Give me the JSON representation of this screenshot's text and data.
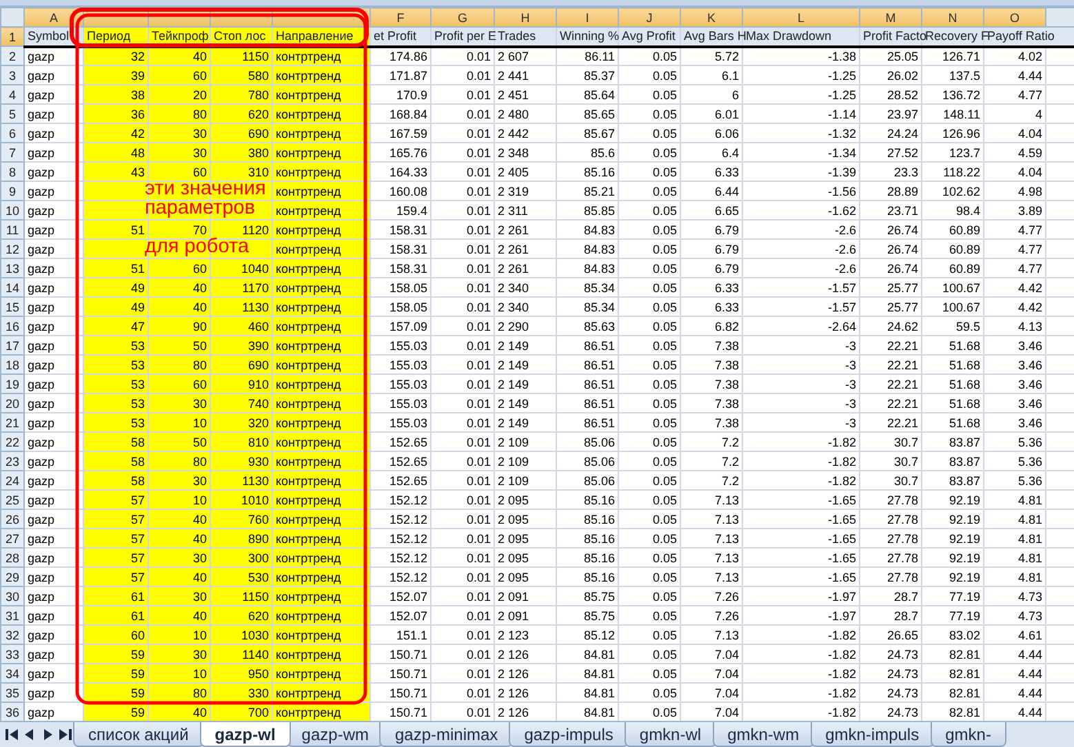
{
  "sheet": {
    "columns": [
      {
        "letter": "A",
        "kind": "text",
        "highlighted": false
      },
      {
        "kind": "number",
        "highlighted": true
      },
      {
        "kind": "number",
        "highlighted": true
      },
      {
        "kind": "number",
        "highlighted": true
      },
      {
        "kind": "text",
        "highlighted": true
      },
      {
        "letter": "F",
        "kind": "number",
        "highlighted": false
      },
      {
        "letter": "G",
        "kind": "number",
        "highlighted": false
      },
      {
        "letter": "H",
        "kind": "text",
        "highlighted": false
      },
      {
        "letter": "I",
        "kind": "number",
        "highlighted": false
      },
      {
        "letter": "J",
        "kind": "number",
        "highlighted": false
      },
      {
        "letter": "K",
        "kind": "number",
        "highlighted": false
      },
      {
        "letter": "L",
        "kind": "number",
        "highlighted": false
      },
      {
        "letter": "M",
        "kind": "number",
        "highlighted": false
      },
      {
        "letter": "N",
        "kind": "number",
        "highlighted": false
      },
      {
        "letter": "O",
        "kind": "number",
        "highlighted": false
      }
    ],
    "header_row": {
      "label": "1",
      "selected": true,
      "cells": [
        "Symbol",
        "Период",
        "Тейкпроф",
        "Стоп лос",
        "Направление",
        "et Profit",
        "Profit per E",
        "Trades",
        "Winning %",
        "Avg Profit",
        "Avg Bars H",
        "Max Drawdown",
        "Profit Facto",
        "Recovery F",
        "Payoff Ratio"
      ]
    },
    "rows": [
      {
        "label": "2",
        "cells": [
          "gazp",
          "32",
          "40",
          "1150",
          "контртренд",
          "174.86",
          "0.01",
          "2 607",
          "86.11",
          "0.05",
          "5.72",
          "-1.38",
          "25.05",
          "126.71",
          "4.02"
        ]
      },
      {
        "label": "3",
        "cells": [
          "gazp",
          "39",
          "60",
          "580",
          "контртренд",
          "171.87",
          "0.01",
          "2 441",
          "85.37",
          "0.05",
          "6.1",
          "-1.25",
          "26.02",
          "137.5",
          "4.44"
        ]
      },
      {
        "label": "4",
        "cells": [
          "gazp",
          "38",
          "20",
          "780",
          "контртренд",
          "170.9",
          "0.01",
          "2 451",
          "85.64",
          "0.05",
          "6",
          "-1.25",
          "28.52",
          "136.72",
          "4.77"
        ]
      },
      {
        "label": "5",
        "cells": [
          "gazp",
          "36",
          "80",
          "620",
          "контртренд",
          "168.84",
          "0.01",
          "2 480",
          "85.65",
          "0.05",
          "6.01",
          "-1.14",
          "23.97",
          "148.11",
          "4"
        ]
      },
      {
        "label": "6",
        "cells": [
          "gazp",
          "42",
          "30",
          "690",
          "контртренд",
          "167.59",
          "0.01",
          "2 442",
          "85.67",
          "0.05",
          "6.06",
          "-1.32",
          "24.24",
          "126.96",
          "4.04"
        ]
      },
      {
        "label": "7",
        "cells": [
          "gazp",
          "48",
          "30",
          "380",
          "контртренд",
          "165.76",
          "0.01",
          "2 348",
          "85.6",
          "0.05",
          "6.4",
          "-1.34",
          "27.52",
          "123.7",
          "4.59"
        ]
      },
      {
        "label": "8",
        "cells": [
          "gazp",
          "43",
          "60",
          "310",
          "контртренд",
          "164.33",
          "0.01",
          "2 405",
          "85.16",
          "0.05",
          "6.33",
          "-1.39",
          "23.3",
          "118.22",
          "4.04"
        ]
      },
      {
        "label": "9",
        "cells": [
          "gazp",
          null,
          null,
          null,
          "контртренд",
          "160.08",
          "0.01",
          "2 319",
          "85.21",
          "0.05",
          "6.44",
          "-1.56",
          "28.89",
          "102.62",
          "4.98"
        ]
      },
      {
        "label": "10",
        "cells": [
          "gazp",
          null,
          null,
          null,
          "контртренд",
          "159.4",
          "0.01",
          "2 311",
          "85.85",
          "0.05",
          "6.65",
          "-1.62",
          "23.71",
          "98.4",
          "3.89"
        ]
      },
      {
        "label": "11",
        "cells": [
          "gazp",
          "51",
          "70",
          "1120",
          "контртренд",
          "158.31",
          "0.01",
          "2 261",
          "84.83",
          "0.05",
          "6.79",
          "-2.6",
          "26.74",
          "60.89",
          "4.77"
        ]
      },
      {
        "label": "12",
        "cells": [
          "gazp",
          null,
          null,
          null,
          "контртренд",
          "158.31",
          "0.01",
          "2 261",
          "84.83",
          "0.05",
          "6.79",
          "-2.6",
          "26.74",
          "60.89",
          "4.77"
        ]
      },
      {
        "label": "13",
        "cells": [
          "gazp",
          "51",
          "60",
          "1040",
          "контртренд",
          "158.31",
          "0.01",
          "2 261",
          "84.83",
          "0.05",
          "6.79",
          "-2.6",
          "26.74",
          "60.89",
          "4.77"
        ]
      },
      {
        "label": "14",
        "cells": [
          "gazp",
          "49",
          "40",
          "1170",
          "контртренд",
          "158.05",
          "0.01",
          "2 340",
          "85.34",
          "0.05",
          "6.33",
          "-1.57",
          "25.77",
          "100.67",
          "4.42"
        ]
      },
      {
        "label": "15",
        "cells": [
          "gazp",
          "49",
          "40",
          "1130",
          "контртренд",
          "158.05",
          "0.01",
          "2 340",
          "85.34",
          "0.05",
          "6.33",
          "-1.57",
          "25.77",
          "100.67",
          "4.42"
        ]
      },
      {
        "label": "16",
        "cells": [
          "gazp",
          "47",
          "90",
          "460",
          "контртренд",
          "157.09",
          "0.01",
          "2 290",
          "85.63",
          "0.05",
          "6.82",
          "-2.64",
          "24.62",
          "59.5",
          "4.13"
        ]
      },
      {
        "label": "17",
        "cells": [
          "gazp",
          "53",
          "50",
          "390",
          "контртренд",
          "155.03",
          "0.01",
          "2 149",
          "86.51",
          "0.05",
          "7.38",
          "-3",
          "22.21",
          "51.68",
          "3.46"
        ]
      },
      {
        "label": "18",
        "cells": [
          "gazp",
          "53",
          "80",
          "690",
          "контртренд",
          "155.03",
          "0.01",
          "2 149",
          "86.51",
          "0.05",
          "7.38",
          "-3",
          "22.21",
          "51.68",
          "3.46"
        ]
      },
      {
        "label": "19",
        "cells": [
          "gazp",
          "53",
          "60",
          "910",
          "контртренд",
          "155.03",
          "0.01",
          "2 149",
          "86.51",
          "0.05",
          "7.38",
          "-3",
          "22.21",
          "51.68",
          "3.46"
        ]
      },
      {
        "label": "20",
        "cells": [
          "gazp",
          "53",
          "30",
          "740",
          "контртренд",
          "155.03",
          "0.01",
          "2 149",
          "86.51",
          "0.05",
          "7.38",
          "-3",
          "22.21",
          "51.68",
          "3.46"
        ]
      },
      {
        "label": "21",
        "cells": [
          "gazp",
          "53",
          "10",
          "320",
          "контртренд",
          "155.03",
          "0.01",
          "2 149",
          "86.51",
          "0.05",
          "7.38",
          "-3",
          "22.21",
          "51.68",
          "3.46"
        ]
      },
      {
        "label": "22",
        "cells": [
          "gazp",
          "58",
          "50",
          "810",
          "контртренд",
          "152.65",
          "0.01",
          "2 109",
          "85.06",
          "0.05",
          "7.2",
          "-1.82",
          "30.7",
          "83.87",
          "5.36"
        ]
      },
      {
        "label": "23",
        "cells": [
          "gazp",
          "58",
          "80",
          "930",
          "контртренд",
          "152.65",
          "0.01",
          "2 109",
          "85.06",
          "0.05",
          "7.2",
          "-1.82",
          "30.7",
          "83.87",
          "5.36"
        ]
      },
      {
        "label": "24",
        "cells": [
          "gazp",
          "58",
          "30",
          "1130",
          "контртренд",
          "152.65",
          "0.01",
          "2 109",
          "85.06",
          "0.05",
          "7.2",
          "-1.82",
          "30.7",
          "83.87",
          "5.36"
        ]
      },
      {
        "label": "25",
        "cells": [
          "gazp",
          "57",
          "10",
          "1010",
          "контртренд",
          "152.12",
          "0.01",
          "2 095",
          "85.16",
          "0.05",
          "7.13",
          "-1.65",
          "27.78",
          "92.19",
          "4.81"
        ]
      },
      {
        "label": "26",
        "cells": [
          "gazp",
          "57",
          "40",
          "760",
          "контртренд",
          "152.12",
          "0.01",
          "2 095",
          "85.16",
          "0.05",
          "7.13",
          "-1.65",
          "27.78",
          "92.19",
          "4.81"
        ]
      },
      {
        "label": "27",
        "cells": [
          "gazp",
          "57",
          "40",
          "890",
          "контртренд",
          "152.12",
          "0.01",
          "2 095",
          "85.16",
          "0.05",
          "7.13",
          "-1.65",
          "27.78",
          "92.19",
          "4.81"
        ]
      },
      {
        "label": "28",
        "cells": [
          "gazp",
          "57",
          "30",
          "300",
          "контртренд",
          "152.12",
          "0.01",
          "2 095",
          "85.16",
          "0.05",
          "7.13",
          "-1.65",
          "27.78",
          "92.19",
          "4.81"
        ]
      },
      {
        "label": "29",
        "cells": [
          "gazp",
          "57",
          "40",
          "530",
          "контртренд",
          "152.12",
          "0.01",
          "2 095",
          "85.16",
          "0.05",
          "7.13",
          "-1.65",
          "27.78",
          "92.19",
          "4.81"
        ]
      },
      {
        "label": "30",
        "cells": [
          "gazp",
          "61",
          "30",
          "1150",
          "контртренд",
          "152.07",
          "0.01",
          "2 091",
          "85.75",
          "0.05",
          "7.26",
          "-1.97",
          "28.7",
          "77.19",
          "4.73"
        ]
      },
      {
        "label": "31",
        "cells": [
          "gazp",
          "61",
          "40",
          "620",
          "контртренд",
          "152.07",
          "0.01",
          "2 091",
          "85.75",
          "0.05",
          "7.26",
          "-1.97",
          "28.7",
          "77.19",
          "4.73"
        ]
      },
      {
        "label": "32",
        "cells": [
          "gazp",
          "60",
          "10",
          "1030",
          "контртренд",
          "151.1",
          "0.01",
          "2 123",
          "85.12",
          "0.05",
          "7.13",
          "-1.82",
          "26.65",
          "83.02",
          "4.61"
        ]
      },
      {
        "label": "33",
        "cells": [
          "gazp",
          "59",
          "30",
          "1140",
          "контртренд",
          "150.71",
          "0.01",
          "2 126",
          "84.81",
          "0.05",
          "7.04",
          "-1.82",
          "24.73",
          "82.81",
          "4.44"
        ]
      },
      {
        "label": "34",
        "cells": [
          "gazp",
          "59",
          "10",
          "950",
          "контртренд",
          "150.71",
          "0.01",
          "2 126",
          "84.81",
          "0.05",
          "7.04",
          "-1.82",
          "24.73",
          "82.81",
          "4.44"
        ]
      },
      {
        "label": "35",
        "cells": [
          "gazp",
          "59",
          "80",
          "330",
          "контртренд",
          "150.71",
          "0.01",
          "2 126",
          "84.81",
          "0.05",
          "7.04",
          "-1.82",
          "24.73",
          "82.81",
          "4.44"
        ]
      },
      {
        "label": "36",
        "cells": [
          "gazp",
          "59",
          "40",
          "700",
          "контртренд",
          "150.71",
          "0.01",
          "2 126",
          "84.81",
          "0.05",
          "7.04",
          "-1.82",
          "24.73",
          "82.81",
          "4.44"
        ]
      }
    ]
  },
  "annotation": {
    "lines": [
      "эти значения",
      "параметров",
      "для робота"
    ]
  },
  "sheet_tabs": [
    {
      "label": "список акций",
      "selected": false
    },
    {
      "label": "gazp-wl",
      "selected": true
    },
    {
      "label": "gazp-wm",
      "selected": false
    },
    {
      "label": "gazp-minimax",
      "selected": false
    },
    {
      "label": "gazp-impuls",
      "selected": false
    },
    {
      "label": "gmkn-wl",
      "selected": false
    },
    {
      "label": "gmkn-wm",
      "selected": false
    },
    {
      "label": "gmkn-impuls",
      "selected": false
    },
    {
      "label": "gmkn-",
      "selected": false
    }
  ]
}
